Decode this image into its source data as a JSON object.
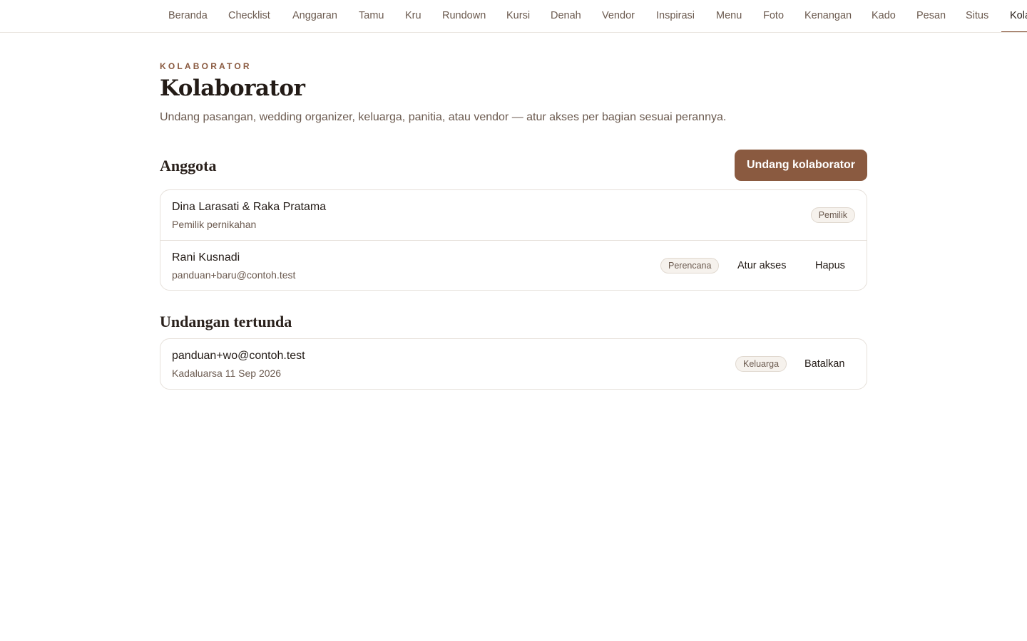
{
  "nav": {
    "tabs": [
      {
        "label": "Beranda"
      },
      {
        "label": "Checklist"
      },
      {
        "label": "Anggaran"
      },
      {
        "label": "Tamu"
      },
      {
        "label": "Kru"
      },
      {
        "label": "Rundown"
      },
      {
        "label": "Kursi"
      },
      {
        "label": "Denah"
      },
      {
        "label": "Vendor"
      },
      {
        "label": "Inspirasi"
      },
      {
        "label": "Menu"
      },
      {
        "label": "Foto"
      },
      {
        "label": "Kenangan"
      },
      {
        "label": "Kado"
      },
      {
        "label": "Pesan"
      },
      {
        "label": "Situs"
      },
      {
        "label": "Kolaborator"
      }
    ],
    "active_index": 16
  },
  "header": {
    "eyebrow": "KOLABORATOR",
    "title": "Kolaborator",
    "subtitle": "Undang pasangan, wedding organizer, keluarga, panitia, atau vendor — atur akses per bagian sesuai perannya."
  },
  "members": {
    "title": "Anggota",
    "invite_button": "Undang kolaborator",
    "rows": [
      {
        "name": "Dina Larasati & Raka Pratama",
        "meta": "Pemilik pernikahan",
        "badge": "Pemilik"
      },
      {
        "name": "Rani Kusnadi",
        "meta": "panduan+baru@contoh.test",
        "badge": "Perencana",
        "action_access": "Atur akses",
        "action_remove": "Hapus"
      }
    ]
  },
  "pending": {
    "title": "Undangan tertunda",
    "rows": [
      {
        "name": "panduan+wo@contoh.test",
        "meta": "Kadaluarsa 11 Sep 2026",
        "badge": "Keluarga",
        "action_cancel": "Batalkan"
      }
    ]
  },
  "colors": {
    "accent": "#8a5a40",
    "border": "#e6e0da",
    "badge_bg": "#f6f2ed"
  }
}
